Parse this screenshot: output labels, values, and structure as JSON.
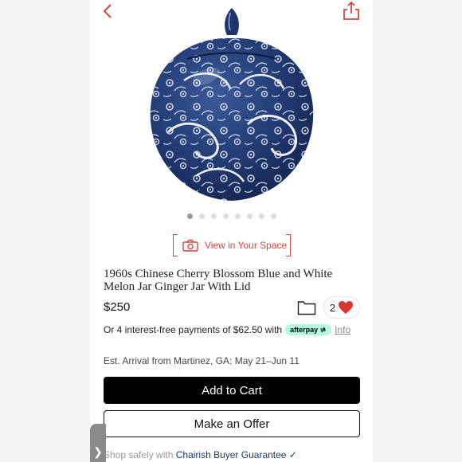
{
  "header": {
    "back_icon": "chevron-left-icon",
    "share_icon": "share-icon"
  },
  "gallery": {
    "image_name": "blue-white-ginger-jar",
    "dot_count": 8,
    "active_index": 0
  },
  "view_in_space": {
    "label": "View in Your Space",
    "icon": "camera-icon"
  },
  "product": {
    "title": "1960s Chinese Cherry Blossom Blue and White Melon Jar Ginger Jar With Lid",
    "price": "$250",
    "favorite_count": "2"
  },
  "afterpay": {
    "text": "Or 4 interest-free payments of $62.50 with",
    "badge": "afterpay",
    "info": "Info"
  },
  "arrival": "Est. Arrival from Martinez, GA: May 21–Jun 11",
  "actions": {
    "add_to_cart": "Add to Cart",
    "make_offer": "Make an Offer"
  },
  "guarantee": {
    "prefix": "Shop safely with",
    "link": "Chairish Buyer Guarantee",
    "check": "✓"
  },
  "drawer_handle": "❯",
  "colors": {
    "accent": "#d0473f",
    "heart": "#d9362f",
    "afterpay_mint": "#b2fce4",
    "porcelain_blue": "#1c2f5e"
  }
}
